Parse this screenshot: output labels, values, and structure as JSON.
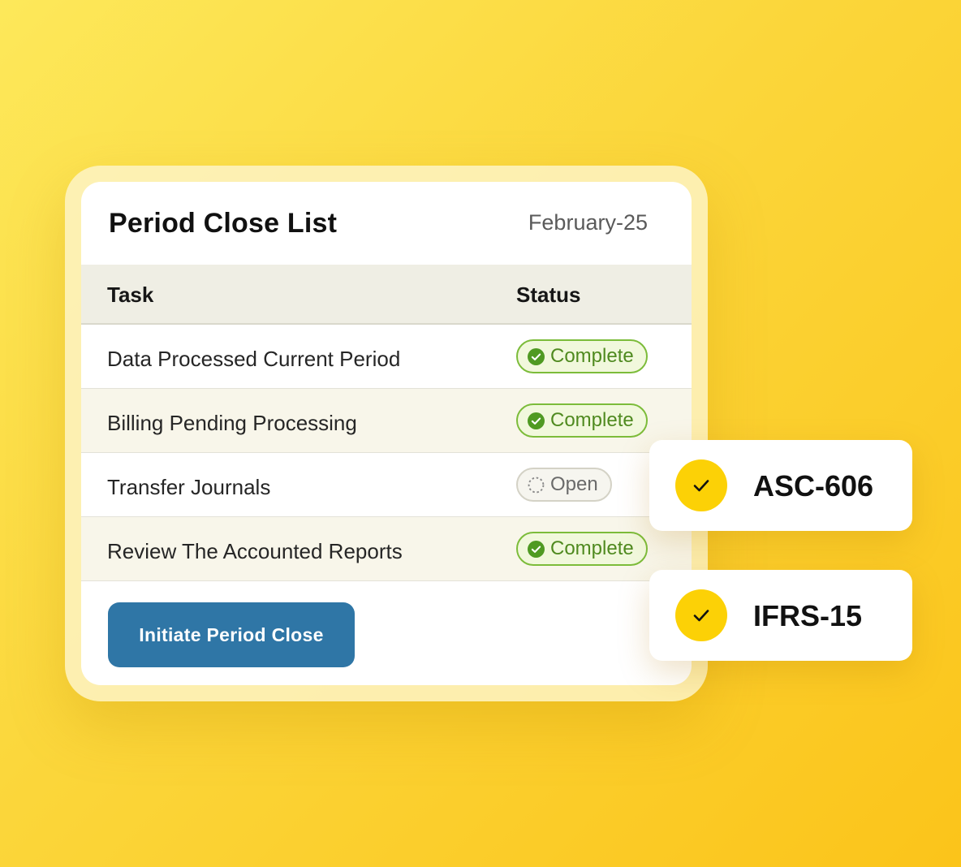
{
  "panel": {
    "title": "Period Close List",
    "period": "February-25",
    "columns": {
      "task": "Task",
      "status": "Status"
    },
    "rows": [
      {
        "task": "Data Processed Current Period",
        "status": "Complete"
      },
      {
        "task": "Billing Pending Processing",
        "status": "Complete"
      },
      {
        "task": "Transfer Journals",
        "status": "Open"
      },
      {
        "task": "Review The Accounted Reports",
        "status": "Complete"
      }
    ],
    "action_label": "Initiate Period Close"
  },
  "standards": [
    {
      "label": "ASC-606",
      "icon": "check-icon"
    },
    {
      "label": "IFRS-15",
      "icon": "check-icon"
    }
  ],
  "colors": {
    "background": "#fbd63a",
    "button": "#2f76a6",
    "complete": "#7cbc3a",
    "check_circle": "#fcd106"
  }
}
